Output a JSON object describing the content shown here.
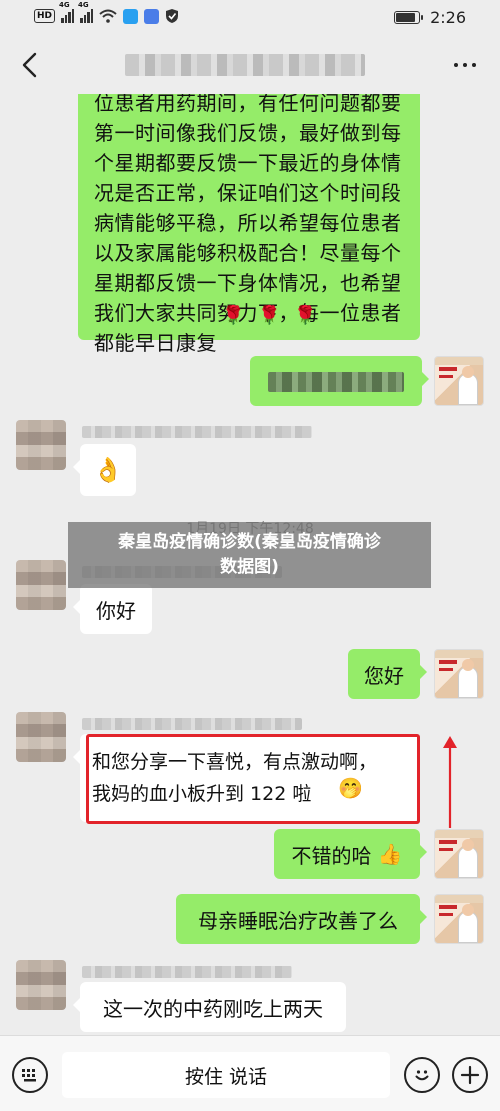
{
  "status_bar": {
    "hd": "HD",
    "network_1": "4G",
    "network_2": "4G",
    "time": "2:26",
    "battery_level": 0.85
  },
  "header": {
    "back_icon": "chevron-left-icon",
    "more_icon": "more-dots-icon"
  },
  "messages": [
    {
      "side": "me",
      "text": "位患者用药期间，有任何问题都要\n第一时间像我们反馈，最好做到每\n个星期都要反馈一下最近的身体情\n况是否正常，保证咱们这个时间段\n病情能够平稳，所以希望每位患者\n以及家属能够积极配合！尽量每个\n星期都反馈一下身体情况，也希望\n我们大家共同努力下，每一位患者\n都能早日康复",
      "emoji": "🌹 🌹 🌹"
    },
    {
      "side": "other",
      "emoji": "👌"
    },
    {
      "side": "other",
      "text": "你好"
    },
    {
      "side": "me",
      "text": "您好"
    },
    {
      "side": "other",
      "text": "和您分享一下喜悦，有点激动啊，\n我妈的血小板升到 122 啦",
      "emoji": "🤭"
    },
    {
      "side": "me",
      "text": "不错的哈",
      "emoji": "👍"
    },
    {
      "side": "me",
      "text": "母亲睡眠治疗改善了么"
    },
    {
      "side": "other",
      "text": "这一次的中药刚吃上两天"
    }
  ],
  "timestamp": "1月19日 下午12:48",
  "overlay_banner": "秦皇岛疫情确诊数(秦皇岛疫情确诊\n数据图)",
  "bottom_bar": {
    "voice_icon": "keyboard-icon",
    "talk_label": "按住 说话",
    "emoji_icon": "smiley-icon",
    "plus_icon": "plus-icon"
  },
  "colors": {
    "my_bubble": "#95ec69",
    "their_bubble": "#ffffff",
    "background": "#ededed",
    "highlight": "#e2232a"
  }
}
